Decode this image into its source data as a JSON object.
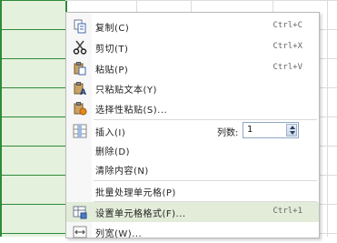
{
  "menu": {
    "items": [
      {
        "label": "复制(C)",
        "shortcut": "Ctrl+C",
        "icon": "copy-icon"
      },
      {
        "label": "剪切(T)",
        "shortcut": "Ctrl+X",
        "icon": "cut-icon"
      },
      {
        "label": "粘贴(P)",
        "shortcut": "Ctrl+V",
        "icon": "paste-icon"
      },
      {
        "label": "只粘贴文本(Y)",
        "icon": "paste-text-icon"
      },
      {
        "label": "选择性粘贴(S)...",
        "icon": "paste-special-icon"
      },
      {
        "label": "插入(I)",
        "icon": "insert-column-icon"
      },
      {
        "label": "删除(D)"
      },
      {
        "label": "清除内容(N)"
      },
      {
        "label": "批量处理单元格(P)"
      },
      {
        "label": "设置单元格格式(F)...",
        "shortcut": "Ctrl+1",
        "icon": "format-cells-icon"
      },
      {
        "label": "列宽(W)...",
        "icon": "column-width-icon"
      }
    ],
    "insert_count": {
      "label": "列数:",
      "value": "1"
    }
  },
  "colors": {
    "selection_fill": "#e4f1dd",
    "selection_border": "#2f8a3a",
    "highlight": "#e2ecd9"
  }
}
